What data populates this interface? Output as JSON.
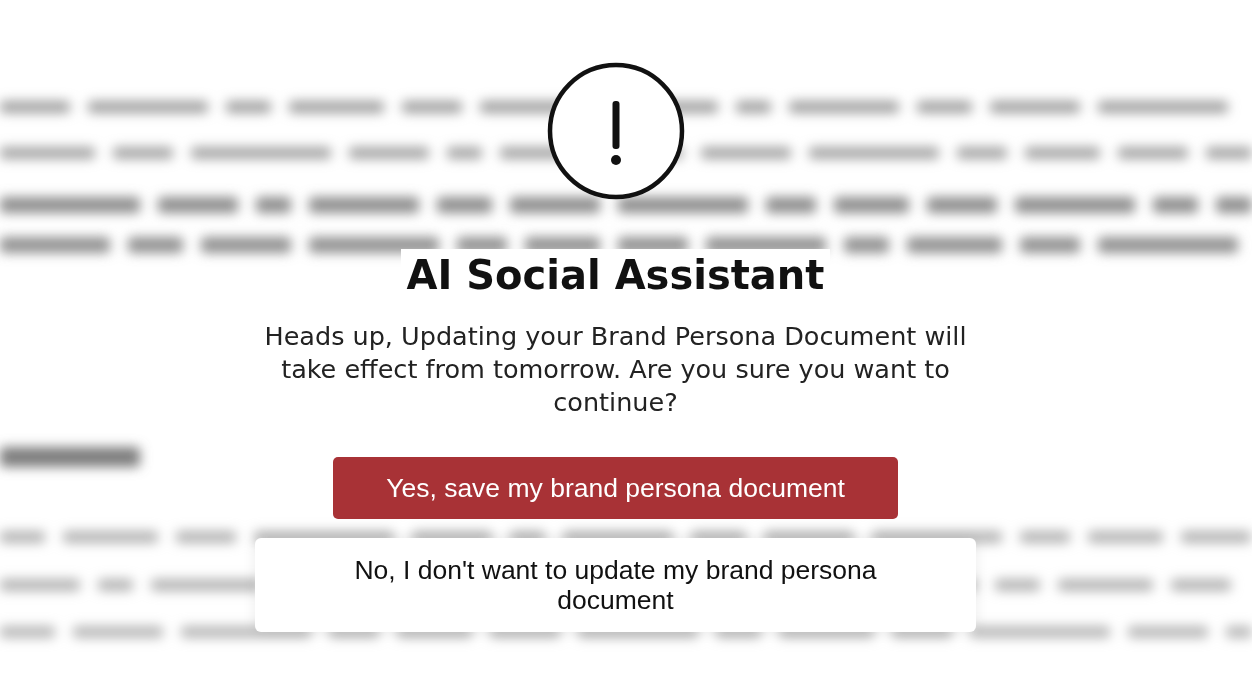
{
  "dialog": {
    "title": "AI Social Assistant",
    "message": "Heads up, Updating your Brand Persona Document will take effect from tomorrow. Are you sure you want to continue?",
    "buttons": [
      {
        "kind": "primary",
        "label": "Yes, save my brand persona document"
      },
      {
        "kind": "secondary",
        "label": "No, I don't want to update my brand persona document"
      }
    ]
  }
}
